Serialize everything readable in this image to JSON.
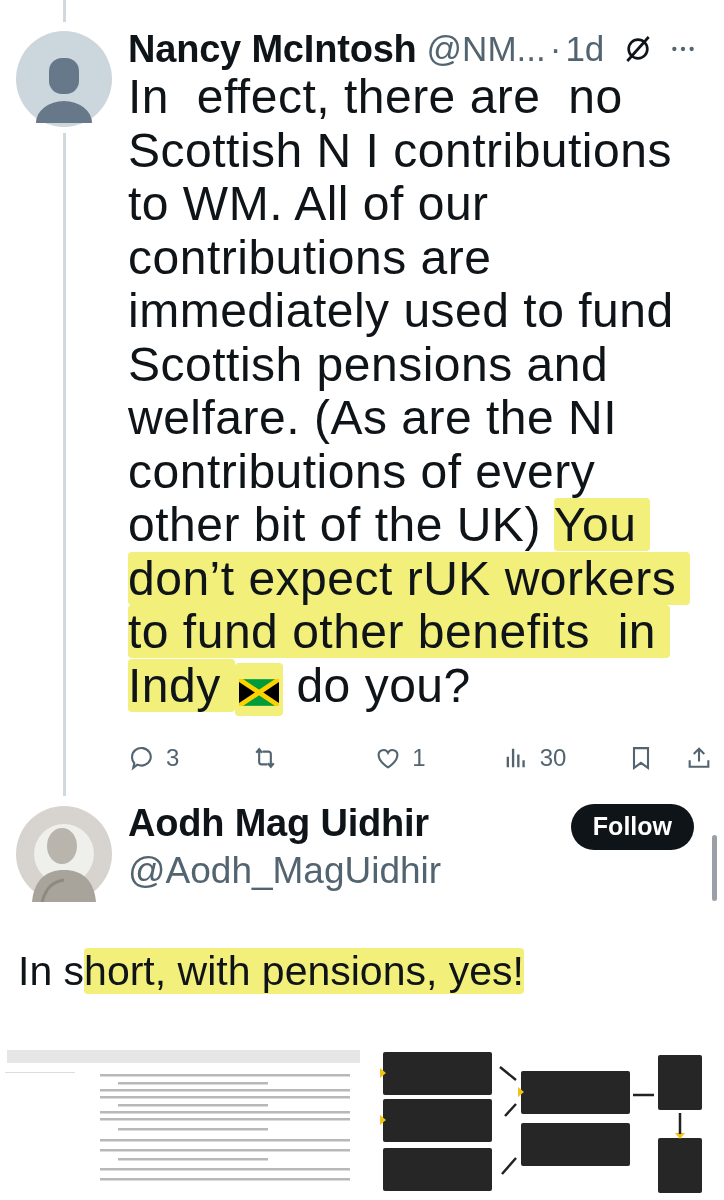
{
  "reply_to": {
    "author_name": "Nancy McIntosh",
    "handle": "@NM...",
    "separator": "·",
    "time": "1d",
    "body": [
      {
        "kind": "text",
        "text": "In  effect, there are  no Scottish N I contributions to WM. All of our contributions are immediately used to fund Scottish pensions and welfare. (As are the NI contributions of every other bit of the UK) ",
        "highlighted": false
      },
      {
        "kind": "text",
        "text": "You don’t expect rUK workers to fund other benefits  in Indy ",
        "highlighted": true
      },
      {
        "kind": "flag",
        "highlighted": true
      },
      {
        "kind": "text",
        "text": " do you?",
        "highlighted": false
      }
    ],
    "actions": [
      {
        "kind": "reply",
        "count": "3"
      },
      {
        "kind": "repost"
      },
      {
        "kind": "like",
        "count": "1"
      },
      {
        "kind": "views",
        "count": "30"
      },
      {
        "kind": "bookmark"
      },
      {
        "kind": "share"
      }
    ]
  },
  "tweet": {
    "author_name": "Aodh Mag Uidhir",
    "handle": "@Aodh_MagUidhir",
    "follow_label": "Follow",
    "body": [
      {
        "kind": "text",
        "text": "In s",
        "highlighted": false
      },
      {
        "kind": "text",
        "text": "hort, with pensions, yes!",
        "highlighted": true
      }
    ]
  }
}
